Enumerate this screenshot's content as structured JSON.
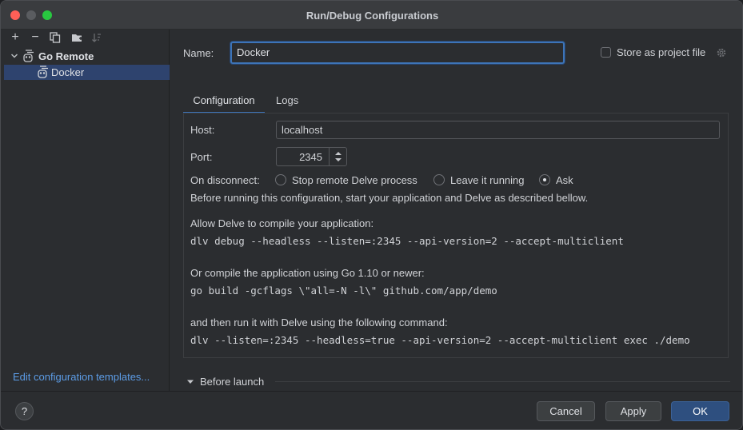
{
  "window": {
    "title": "Run/Debug Configurations"
  },
  "sidebar": {
    "toolbar": {
      "add": "+",
      "remove": "−"
    },
    "tree": {
      "group_label": "Go Remote",
      "child_label": "Docker"
    },
    "edit_templates_link": "Edit configuration templates..."
  },
  "form": {
    "name_label": "Name:",
    "name_value": "Docker",
    "store_label": "Store as project file",
    "tabs": [
      "Configuration",
      "Logs"
    ],
    "host_label": "Host:",
    "host_value": "localhost",
    "port_label": "Port:",
    "port_value": "2345",
    "disconnect_label": "On disconnect:",
    "disconnect_options": [
      "Stop remote Delve process",
      "Leave it running",
      "Ask"
    ],
    "disconnect_selected": "Ask",
    "info_line": "Before running this configuration, start your application and Delve as described bellow.",
    "allow_label": "Allow Delve to compile your application:",
    "allow_cmd": "dlv debug --headless --listen=:2345 --api-version=2 --accept-multiclient",
    "or_label": "Or compile the application using Go 1.10 or newer:",
    "or_cmd": "go build -gcflags \\\"all=-N -l\\\" github.com/app/demo",
    "then_label": "and then run it with Delve using the following command:",
    "then_cmd": "dlv --listen=:2345 --headless=true --api-version=2 --accept-multiclient exec ./demo",
    "before_launch": "Before launch"
  },
  "footer": {
    "help": "?",
    "cancel": "Cancel",
    "apply": "Apply",
    "ok": "OK"
  },
  "colors": {
    "accent": "#3d74b8",
    "selection": "#2e436e",
    "link": "#5c9ce6",
    "ok_button": "#2e4f7f"
  }
}
